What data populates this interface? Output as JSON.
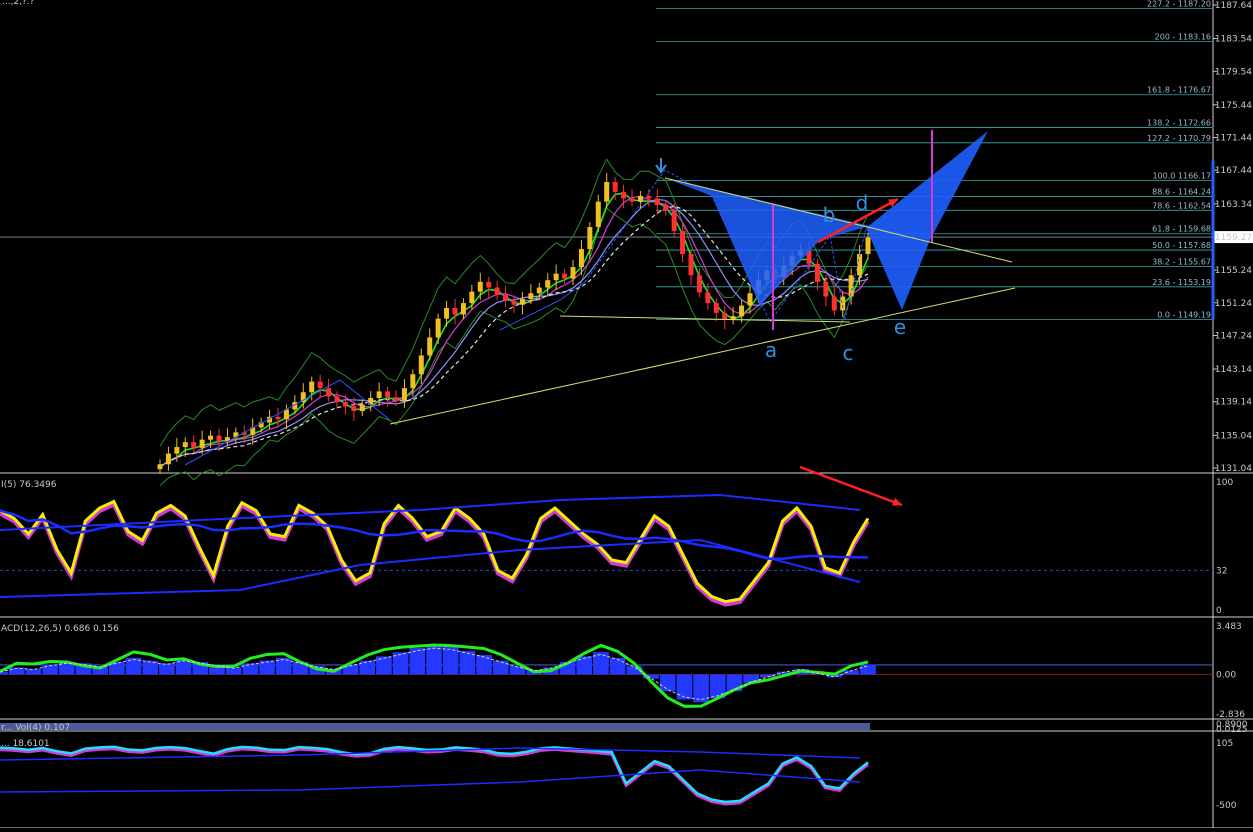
{
  "title_fragment": "...,2,?.?",
  "colors": {
    "background": "#000000",
    "axis": "#c8c8c8",
    "bull_candle": "#f0c020",
    "bear_candle": "#ff3030",
    "fib_line": "#3aa6a6",
    "harmonic_fill": "#1e5fff",
    "magenta": "#d23cd2",
    "red_arrow": "#ff2020",
    "trendline": "#d4e070",
    "wave_label": "#2f8fe0"
  },
  "price_panel": {
    "ticks": [
      "1187.64",
      "1183.54",
      "1179.54",
      "1175.44",
      "1171.44",
      "1167.44",
      "1163.34",
      "1159.27",
      "1155.24",
      "1151.24",
      "1147.24",
      "1143.14",
      "1139.14",
      "1135.04",
      "1131.04"
    ],
    "current_price": "1159.27",
    "fib_levels": [
      "227.2 - 1187.20",
      "200 - 1183.16",
      "161.8 - 1176.67",
      "138.2 - 1172.66",
      "127.2 - 1170.79",
      "100.0 1166.17",
      "88.6 - 1164.24",
      "78.6 - 1162.54",
      "61.8 - 1159.68",
      "50.0 - 1157.68",
      "38.2 - 1155.67",
      "23.6 - 1153.19",
      "0.0 - 1149.19"
    ],
    "wave_labels": [
      "a",
      "b",
      "c",
      "d",
      "e"
    ]
  },
  "rsi_panel": {
    "label": "I(5) 76.3496",
    "ticks": [
      "100",
      "32",
      "0"
    ]
  },
  "macd_panel": {
    "label": "ACD(12,26,5) 0.686 0.156",
    "ticks": [
      "3.483",
      "0.00",
      "-2.836"
    ]
  },
  "volume_panel": {
    "label": "r... Vol(4) 0.107",
    "ticks": [
      "0.8900",
      "0.0125"
    ]
  },
  "osc_panel": {
    "label": "... 18.6101",
    "ticks": [
      "105",
      "-500"
    ]
  },
  "chart_data": [
    {
      "type": "candlestick",
      "title": "",
      "ylim": [
        1131.04,
        1187.64
      ],
      "y_ticks": [
        1187.64,
        1183.54,
        1179.54,
        1175.44,
        1171.44,
        1167.44,
        1163.34,
        1159.27,
        1155.24,
        1151.24,
        1147.24,
        1143.14,
        1139.14,
        1135.04,
        1131.04
      ],
      "close": [
        1131.5,
        1132.8,
        1133.6,
        1134.2,
        1133.5,
        1134.5,
        1135.0,
        1134.3,
        1134.8,
        1135.4,
        1135.1,
        1136.0,
        1136.6,
        1137.3,
        1137.0,
        1138.2,
        1139.1,
        1140.3,
        1141.6,
        1140.8,
        1139.8,
        1139.1,
        1138.6,
        1138.0,
        1138.8,
        1139.6,
        1140.4,
        1139.7,
        1139.2,
        1140.8,
        1142.5,
        1144.8,
        1147.0,
        1149.3,
        1150.6,
        1149.8,
        1151.2,
        1152.6,
        1153.8,
        1153.1,
        1152.2,
        1151.5,
        1151.0,
        1151.7,
        1152.4,
        1153.1,
        1154.0,
        1154.8,
        1154.2,
        1155.6,
        1157.8,
        1160.5,
        1163.6,
        1166.0,
        1164.8,
        1164.0,
        1163.6,
        1164.3,
        1164.0,
        1163.2,
        1162.5,
        1160.0,
        1157.2,
        1154.6,
        1152.5,
        1151.2,
        1150.0,
        1149.2,
        1149.6,
        1150.9,
        1152.4,
        1154.0,
        1155.2,
        1154.4,
        1155.8,
        1157.0,
        1157.6,
        1156.0,
        1153.8,
        1152.0,
        1150.3,
        1152.0,
        1154.6,
        1157.2,
        1159.2
      ],
      "fibonacci_levels": [
        {
          "ratio": 227.2,
          "price": 1187.2
        },
        {
          "ratio": 200,
          "price": 1183.16
        },
        {
          "ratio": 161.8,
          "price": 1176.67
        },
        {
          "ratio": 138.2,
          "price": 1172.66
        },
        {
          "ratio": 127.2,
          "price": 1170.79
        },
        {
          "ratio": 100.0,
          "price": 1166.17
        },
        {
          "ratio": 88.6,
          "price": 1164.24
        },
        {
          "ratio": 78.6,
          "price": 1162.54
        },
        {
          "ratio": 61.8,
          "price": 1159.68
        },
        {
          "ratio": 50.0,
          "price": 1157.68
        },
        {
          "ratio": 38.2,
          "price": 1155.67
        },
        {
          "ratio": 23.6,
          "price": 1153.19
        },
        {
          "ratio": 0.0,
          "price": 1149.19
        }
      ],
      "annotations": [
        "a",
        "b",
        "c",
        "d",
        "e"
      ]
    },
    {
      "type": "line",
      "title": "I(5) 76.3496",
      "ylim": [
        0,
        100
      ],
      "level_line": 32,
      "series": [
        {
          "name": "I(5)",
          "values": [
            78,
            72,
            60,
            75,
            48,
            30,
            70,
            80,
            85,
            62,
            55,
            76,
            82,
            74,
            50,
            28,
            66,
            84,
            78,
            60,
            58,
            82,
            76,
            66,
            40,
            24,
            30,
            68,
            82,
            72,
            58,
            62,
            80,
            72,
            60,
            32,
            26,
            44,
            72,
            80,
            70,
            60,
            52,
            40,
            38,
            56,
            74,
            66,
            44,
            22,
            12,
            8,
            10,
            24,
            38,
            70,
            80,
            66,
            34,
            30,
            54,
            72
          ]
        }
      ]
    },
    {
      "type": "bar",
      "title": "ACD(12,26,5) 0.686 0.156",
      "ylim": [
        -2.836,
        3.483
      ],
      "values": [
        0.2,
        0.5,
        0.4,
        0.7,
        0.9,
        0.8,
        0.6,
        0.9,
        1.2,
        1.0,
        0.8,
        1.1,
        0.9,
        0.7,
        0.5,
        0.8,
        1.0,
        1.2,
        0.9,
        0.6,
        0.4,
        0.7,
        1.0,
        1.3,
        1.6,
        1.9,
        2.1,
        2.0,
        1.7,
        1.4,
        1.0,
        0.6,
        0.3,
        0.5,
        0.9,
        1.3,
        1.6,
        1.2,
        0.6,
        -0.3,
        -1.2,
        -1.8,
        -2.0,
        -1.7,
        -1.2,
        -0.6,
        -0.2,
        0.2,
        0.4,
        0.1,
        -0.2,
        0.3,
        0.7
      ]
    }
  ]
}
